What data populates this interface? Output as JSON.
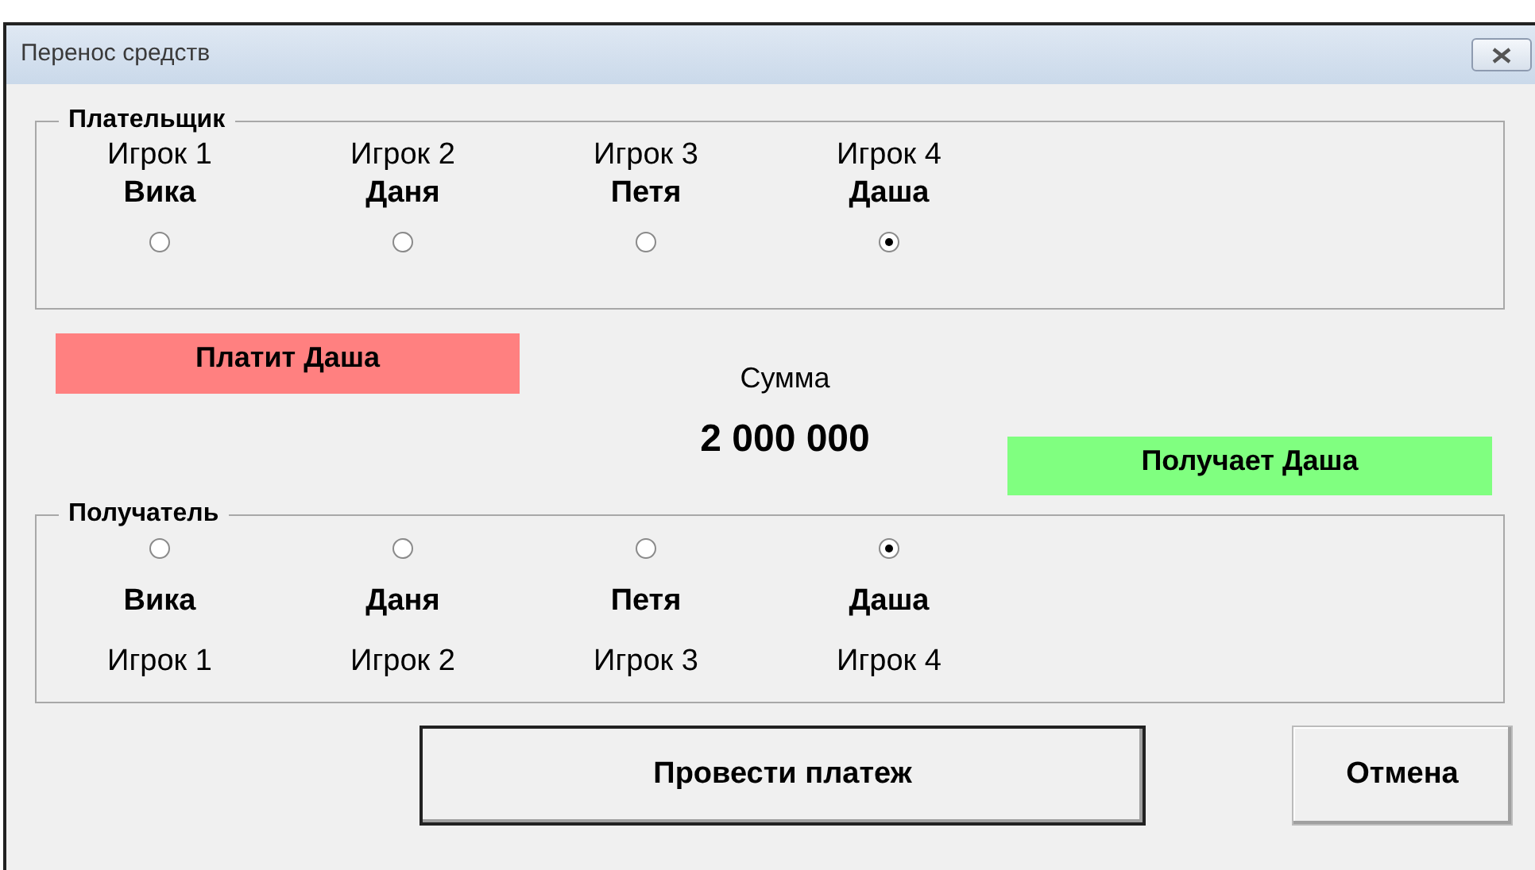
{
  "window": {
    "title": "Перенос средств"
  },
  "payer": {
    "legend": "Плательщик",
    "players": [
      {
        "label": "Игрок 1",
        "name": "Вика",
        "selected": false
      },
      {
        "label": "Игрок 2",
        "name": "Даня",
        "selected": false
      },
      {
        "label": "Игрок 3",
        "name": "Петя",
        "selected": false
      },
      {
        "label": "Игрок 4",
        "name": "Даша",
        "selected": true
      }
    ]
  },
  "payer_banner": "Платит Даша",
  "amount": {
    "label": "Сумма",
    "value": "2 000 000"
  },
  "receiver_banner": "Получает Даша",
  "receiver": {
    "legend": "Получатель",
    "players": [
      {
        "label": "Игрок 1",
        "name": "Вика",
        "selected": false
      },
      {
        "label": "Игрок 2",
        "name": "Даня",
        "selected": false
      },
      {
        "label": "Игрок 3",
        "name": "Петя",
        "selected": false
      },
      {
        "label": "Игрок 4",
        "name": "Даша",
        "selected": true
      }
    ]
  },
  "buttons": [
    {
      "kind": "primary",
      "label": "Провести платеж"
    },
    {
      "kind": "secondary",
      "label": "Отмена"
    }
  ]
}
